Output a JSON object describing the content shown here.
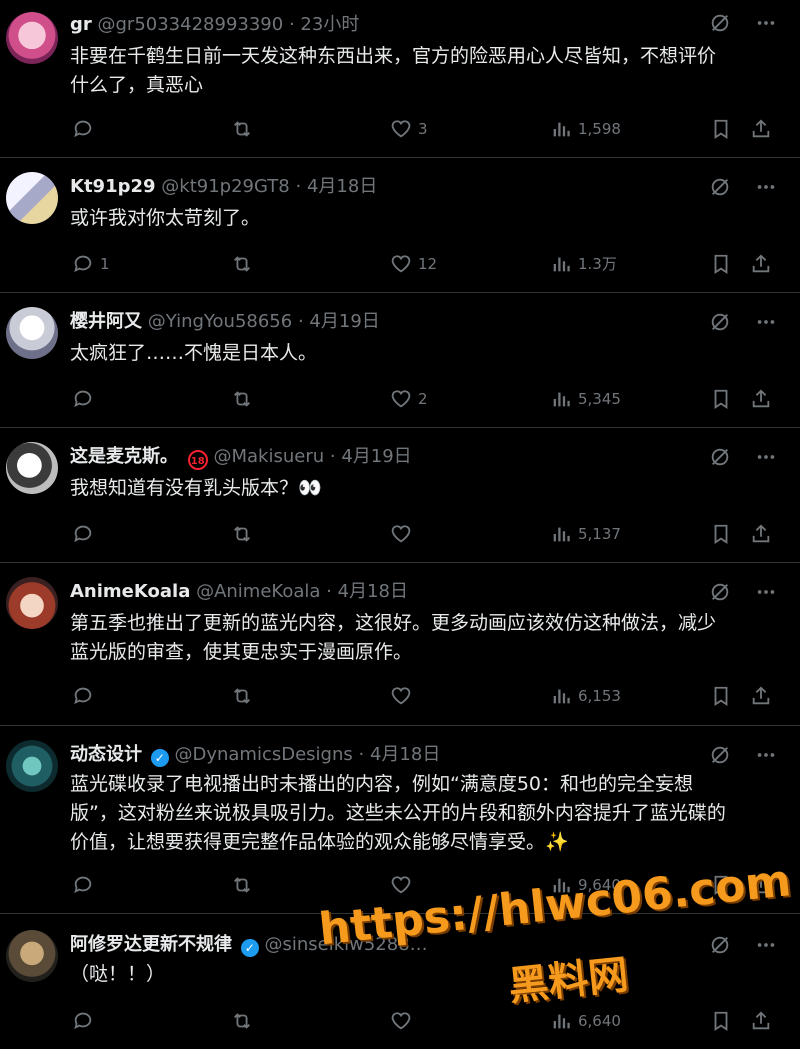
{
  "colors": {
    "accent": "#1d9bf0",
    "watermark": "#f59a1c",
    "muted": "#71767b"
  },
  "tweets": [
    {
      "name": "gr",
      "handle": "@gr5033428993390",
      "time": "23小时",
      "lines": [
        "非要在千鹤生日前一天发这种东西出来，官方的险恶用心人尽皆知，不想评价",
        "什么了，真恶心"
      ],
      "replies": "",
      "retweets": "",
      "likes": "3",
      "views": "1,598"
    },
    {
      "name": "Kt91p29",
      "handle": "@kt91p29GT8",
      "time": "4月18日",
      "lines": [
        "或许我对你太苛刻了。"
      ],
      "replies": "1",
      "retweets": "",
      "likes": "12",
      "views": "1.3万"
    },
    {
      "name": "樱井阿又",
      "handle": "@YingYou58656",
      "time": "4月19日",
      "lines": [
        "太疯狂了……不愧是日本人。"
      ],
      "replies": "",
      "retweets": "",
      "likes": "2",
      "views": "5,345"
    },
    {
      "name": "这是麦克斯。",
      "age_badge": "18",
      "handle": "@Makisueru",
      "time": "4月19日",
      "lines": [
        "我想知道有没有乳头版本？👀"
      ],
      "replies": "",
      "retweets": "",
      "likes": "",
      "views": "5,137"
    },
    {
      "name": "AnimeKoala",
      "handle": "@AnimeKoala",
      "time": "4月18日",
      "lines": [
        "第五季也推出了更新的蓝光内容，这很好。更多动画应该效仿这种做法，减少",
        "蓝光版的审查，使其更忠实于漫画原作。"
      ],
      "replies": "",
      "retweets": "",
      "likes": "",
      "views": "6,153"
    },
    {
      "name": "动态设计",
      "verified": true,
      "handle": "@DynamicsDesigns",
      "time": "4月18日",
      "lines": [
        "蓝光碟收录了电视播出时未播出的内容，例如“满意度50：和也的完全妄想",
        "版”，这对粉丝来说极具吸引力。这些未公开的片段和额外内容提升了蓝光碟的",
        "价值，让想要获得更完整作品体验的观众能够尽情享受。✨"
      ],
      "replies": "",
      "retweets": "",
      "likes": "",
      "views": "9,640"
    },
    {
      "name": "阿修罗达更新不规律",
      "verified": true,
      "handle": "@sinseikiw5288…",
      "time": "",
      "lines": [
        "（哒！！）"
      ],
      "replies": "",
      "retweets": "",
      "likes": "",
      "views": "6,640"
    }
  ],
  "watermark": {
    "line1": "https://hlwc06.com",
    "line2": "黑料网"
  }
}
